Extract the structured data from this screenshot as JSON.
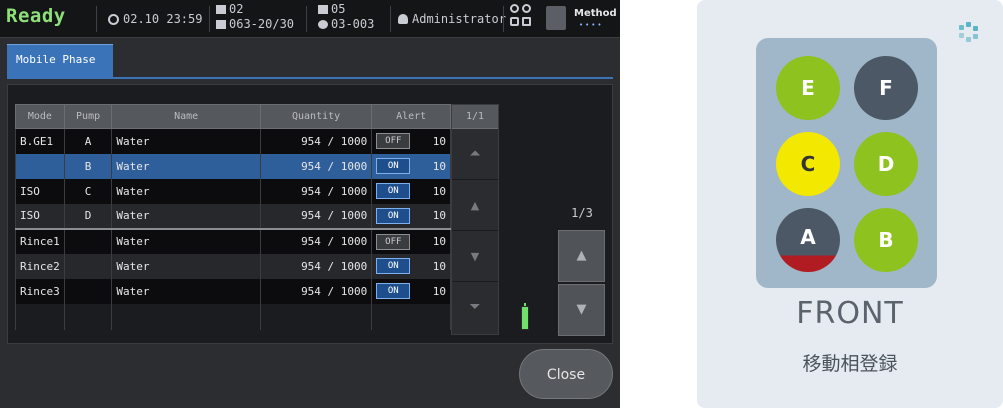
{
  "topbar": {
    "status": "Ready",
    "datetime": "02.10 23:59",
    "slot_line1": "02",
    "slot_line2": "063-20/30",
    "tray_line1": "05",
    "tray_line2": "03-003",
    "user": "Administrator",
    "method_label": "Method",
    "method_dots": "••••"
  },
  "tab": {
    "label": "Mobile Phase"
  },
  "table": {
    "headers": [
      "Mode",
      "Pump",
      "Name",
      "Quantity",
      "Alert"
    ],
    "page_header": "1/1",
    "rows": [
      {
        "mode": "B.GE1",
        "pump": "A",
        "name": "Water",
        "quantity": "954 / 1000",
        "switch": "OFF",
        "alert": "10"
      },
      {
        "mode": "",
        "pump": "B",
        "name": "Water",
        "quantity": "954 / 1000",
        "switch": "ON",
        "alert": "10"
      },
      {
        "mode": "ISO",
        "pump": "C",
        "name": "Water",
        "quantity": "954 / 1000",
        "switch": "ON",
        "alert": "10"
      },
      {
        "mode": "ISO",
        "pump": "D",
        "name": "Water",
        "quantity": "954 / 1000",
        "switch": "ON",
        "alert": "10"
      },
      {
        "mode": "Rince1",
        "pump": "",
        "name": "Water",
        "quantity": "954 / 1000",
        "switch": "OFF",
        "alert": "10"
      },
      {
        "mode": "Rince2",
        "pump": "",
        "name": "Water",
        "quantity": "954 / 1000",
        "switch": "ON",
        "alert": "10"
      },
      {
        "mode": "Rince3",
        "pump": "",
        "name": "Water",
        "quantity": "954 / 1000",
        "switch": "ON",
        "alert": "10"
      }
    ]
  },
  "pager": {
    "indicator": "1/3"
  },
  "close_label": "Close",
  "card": {
    "pumps": {
      "E": "E",
      "F": "F",
      "C": "C",
      "D": "D",
      "A": "A",
      "B": "B"
    },
    "front_label": "FRONT",
    "caption": "移動相登録"
  },
  "colors": {
    "ready": "#8fe07a",
    "accent_blue": "#3a73b8",
    "pump_green": "#8ec21f",
    "pump_gray": "#4c5866",
    "pump_yellow": "#f3e800",
    "pump_alert_red": "#b11c22"
  },
  "icons": [
    "clock-icon",
    "slot-icon",
    "tray-icon",
    "user-icon",
    "lock-icon",
    "method-doc-icon",
    "battery-icon",
    "spinner-icon"
  ]
}
